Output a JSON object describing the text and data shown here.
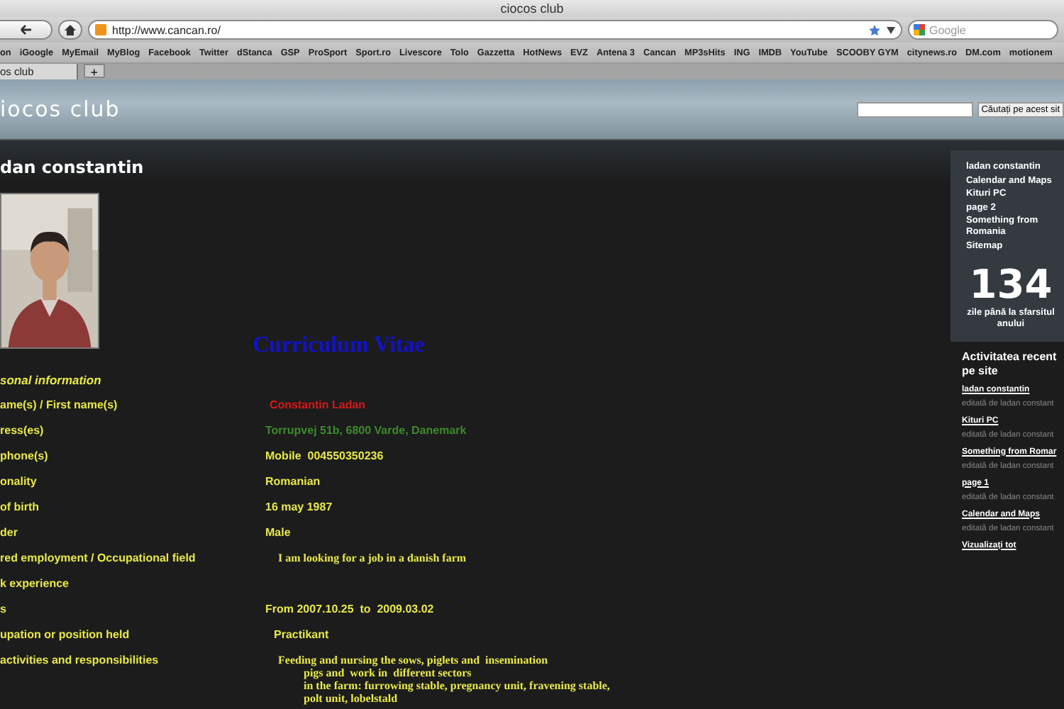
{
  "window": {
    "title": "ciocos club"
  },
  "toolbar": {
    "url": "http://www.cancan.ro/",
    "search_placeholder": "Google"
  },
  "bookmarks": [
    "on",
    "iGoogle",
    "MyEmail",
    "MyBlog",
    "Facebook",
    "Twitter",
    "dStanca",
    "GSP",
    "ProSport",
    "Sport.ro",
    "Livescore",
    "Tolo",
    "Gazzetta",
    "HotNews",
    "EVZ",
    "Antena 3",
    "Cancan",
    "MP3sHits",
    "ING",
    "IMDB",
    "YouTube",
    "SCOOBY GYM",
    "citynews.ro",
    "DM.com",
    "motionem"
  ],
  "tabs": [
    {
      "label": "os club",
      "selected": true
    }
  ],
  "new_tab": "+",
  "site": {
    "title": "iocos club",
    "search_button": "Căutați pe acest sit"
  },
  "page": {
    "heading": "dan constantin",
    "cv_title": "Curriculum Vitae",
    "section": "sonal information",
    "rows": [
      {
        "label": "ame(s) / First name(s)",
        "kind": "name",
        "lines": [
          "Constantin Ladan"
        ]
      },
      {
        "label": "ress(es)",
        "kind": "address",
        "lines": [
          "Torrupvej 51b, 6800 Varde, Danemark"
        ]
      },
      {
        "label": "phone(s)",
        "kind": "plain",
        "lines": [
          "Mobile  004550350236"
        ]
      },
      {
        "label": "onality",
        "kind": "plain",
        "lines": [
          "Romanian"
        ]
      },
      {
        "label": "of birth",
        "kind": "plain",
        "lines": [
          "16 may 1987"
        ]
      },
      {
        "label": "der",
        "kind": "plain",
        "lines": [
          "Male"
        ]
      },
      {
        "label": "red employment / Occupational field",
        "kind": "serif",
        "lines": [
          "I am looking for a job in a danish farm"
        ]
      },
      {
        "label": "k experience",
        "lines": []
      },
      {
        "label": "s",
        "kind": "plain",
        "lines": [
          "From 2007.10.25  to  2009.03.02"
        ]
      },
      {
        "label": "upation or position held",
        "kind": "indent",
        "lines": [
          "Practikant"
        ]
      },
      {
        "label": "activities and responsibilities",
        "kind": "serif",
        "lines": [
          "Feeding and nursing the sows, piglets and  insemination",
          "pigs and  work in  different sectors",
          "in the farm: furrowing stable, pregnancy unit, fravening stable,",
          "polt unit, lobelstald"
        ]
      }
    ]
  },
  "sidebar": {
    "links": [
      "ladan constantin",
      "Calendar and Maps",
      "Kituri PC",
      "page 2",
      "Something from Romania",
      "Sitemap"
    ],
    "count": "134",
    "count_caption": "zile până la sfarsitul anului",
    "recent_heading": "Activitatea recent pe site",
    "recent": [
      {
        "title": "ladan constantin",
        "meta": "editată de ladan constant"
      },
      {
        "title": "Kituri PC",
        "meta": "editată de ladan constant"
      },
      {
        "title": "Something from Romar",
        "meta": "editată de ladan constant"
      },
      {
        "title": "page 1",
        "meta": "editată de ladan constant"
      },
      {
        "title": "Calendar and Maps",
        "meta": "editată de ladan constant"
      }
    ],
    "view_all": "Vizualizați tot"
  }
}
